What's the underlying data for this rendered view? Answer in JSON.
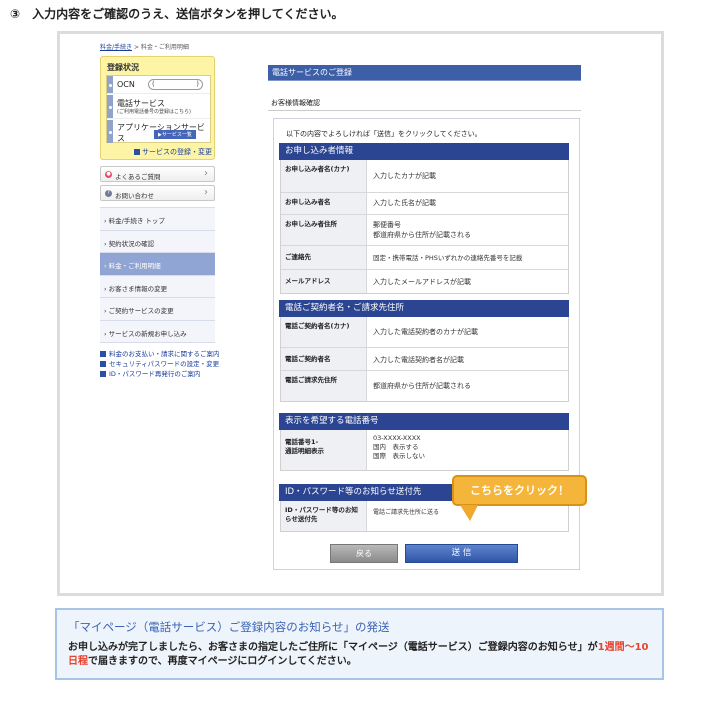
{
  "step_title": "③　入力内容をご確認のうえ、送信ボタンを押してください。",
  "breadcrumb": {
    "home": "料金/手続き",
    "sep": ">",
    "current": "料金・ご利用明細"
  },
  "registration": {
    "title": "登録状況",
    "ocn_label": "OCN",
    "ocn_pill_left": "(",
    "ocn_pill_right": ")",
    "phone_service": "電話サービス",
    "phone_service_sub": "(ご利用電話番号の登録はこちら)",
    "app_service": "アプリケーションサービス",
    "app_service_badge": "▶サービス一覧",
    "register_link": "サービスの登録・変更"
  },
  "help_buttons": [
    {
      "label": "よくあるご質問",
      "icon": "faq-icon",
      "color": "#e34b6a"
    },
    {
      "label": "お問い合わせ",
      "icon": "question-icon",
      "color": "#6f7c99"
    }
  ],
  "nav_items": [
    {
      "label": "› 料金/手続き トップ",
      "active": false
    },
    {
      "label": "› 契約状況の確認",
      "active": false
    },
    {
      "label": "› 料金・ご利用明細",
      "active": true
    },
    {
      "label": "› お客さま情報の変更",
      "active": false
    },
    {
      "label": "› ご契約サービスの変更",
      "active": false
    },
    {
      "label": "› サービスの新規お申し込み",
      "active": false
    }
  ],
  "side_links": [
    "料金のお支払い・請求に関するご案内",
    "セキュリティパスワードの設定・変更",
    "ID・パスワード再発行のご案内"
  ],
  "page_heading": "電話サービスのご登録",
  "sub_heading": "お客様情報確認",
  "intro_text": "以下の内容でよろしければ「送信」をクリックしてください。",
  "sections": [
    {
      "title": "お申し込み者情報",
      "rows": [
        {
          "label": "お申し込み者名(カナ)",
          "value": "入力したカナが記載"
        },
        {
          "label": "お申し込み者名",
          "value": "入力した氏名が記載"
        },
        {
          "label": "お申し込み者住所",
          "value": "郵便番号\n都道府県から住所が記載される"
        },
        {
          "label": "ご連絡先",
          "value": "固定・携帯電話・PHSいずれかの連絡先番号を記載"
        },
        {
          "label": "メールアドレス",
          "value": "入力したメールアドレスが記載"
        }
      ]
    },
    {
      "title": "電話ご契約者名・ご請求先住所",
      "rows": [
        {
          "label": "電話ご契約者名(カナ)",
          "value": "入力した電話契約者のカナが記載"
        },
        {
          "label": "電話ご契約者名",
          "value": "入力した電話契約者名が記載"
        },
        {
          "label": "電話ご請求先住所",
          "value": "都道府県から住所が記載される"
        }
      ]
    },
    {
      "title": "表示を希望する電話番号",
      "rows": [
        {
          "label": "電話番号1-\n通話明細表示",
          "value": "03-XXXX-XXXX\n国内　表示する\n国際　表示しない"
        }
      ]
    },
    {
      "title": "ID・パスワード等のお知らせ送付先",
      "rows": [
        {
          "label": "ID・パスワード等のお知らせ送付先",
          "value": "電話ご請求先住所に送る"
        }
      ]
    }
  ],
  "callout": "こちらをクリック！",
  "buttons": {
    "back": "戻る",
    "send": "送 信"
  },
  "notice": {
    "title": "「マイページ（電話サービス）ご登録内容のお知らせ」の発送",
    "body_before": "お申し込みが完了しましたら、お客さまの指定したご住所に「マイページ（電話サービス）ご登録内容のお知らせ」が",
    "body_highlight": "1週間〜10日程",
    "body_after": "で届きますので、再度マイページにログインしてください。"
  },
  "colors": {
    "accent": "#2c4592",
    "callout": "#f5b53a",
    "highlight": "#e8412c"
  }
}
